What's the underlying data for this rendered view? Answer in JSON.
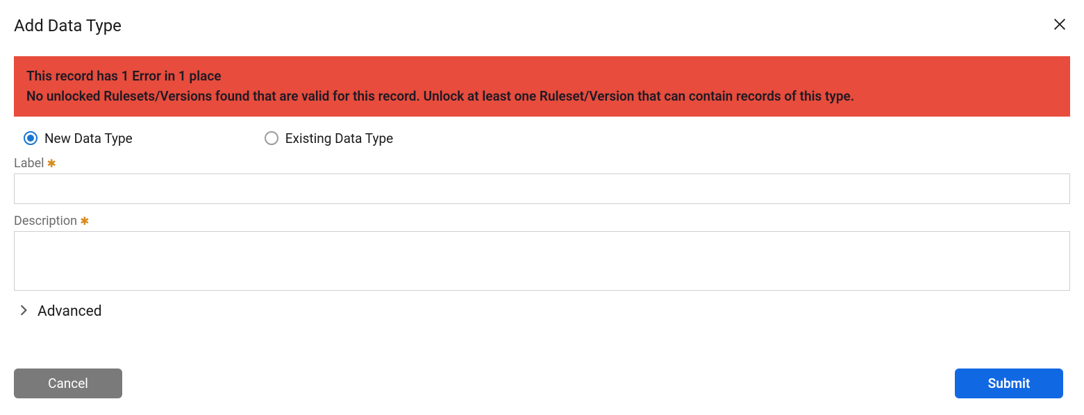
{
  "dialog": {
    "title": "Add Data Type"
  },
  "error": {
    "line1": "This record has 1 Error in 1 place",
    "line2": "No unlocked Rulesets/Versions found that are valid for this record. Unlock at least one Ruleset/Version that can contain records of this type."
  },
  "radios": {
    "new_data_type": "New Data Type",
    "existing_data_type": "Existing Data Type",
    "selected": "new_data_type"
  },
  "fields": {
    "label": {
      "label": "Label",
      "value": ""
    },
    "description": {
      "label": "Description",
      "value": ""
    }
  },
  "advanced": {
    "label": "Advanced",
    "expanded": false
  },
  "buttons": {
    "cancel": "Cancel",
    "submit": "Submit"
  }
}
